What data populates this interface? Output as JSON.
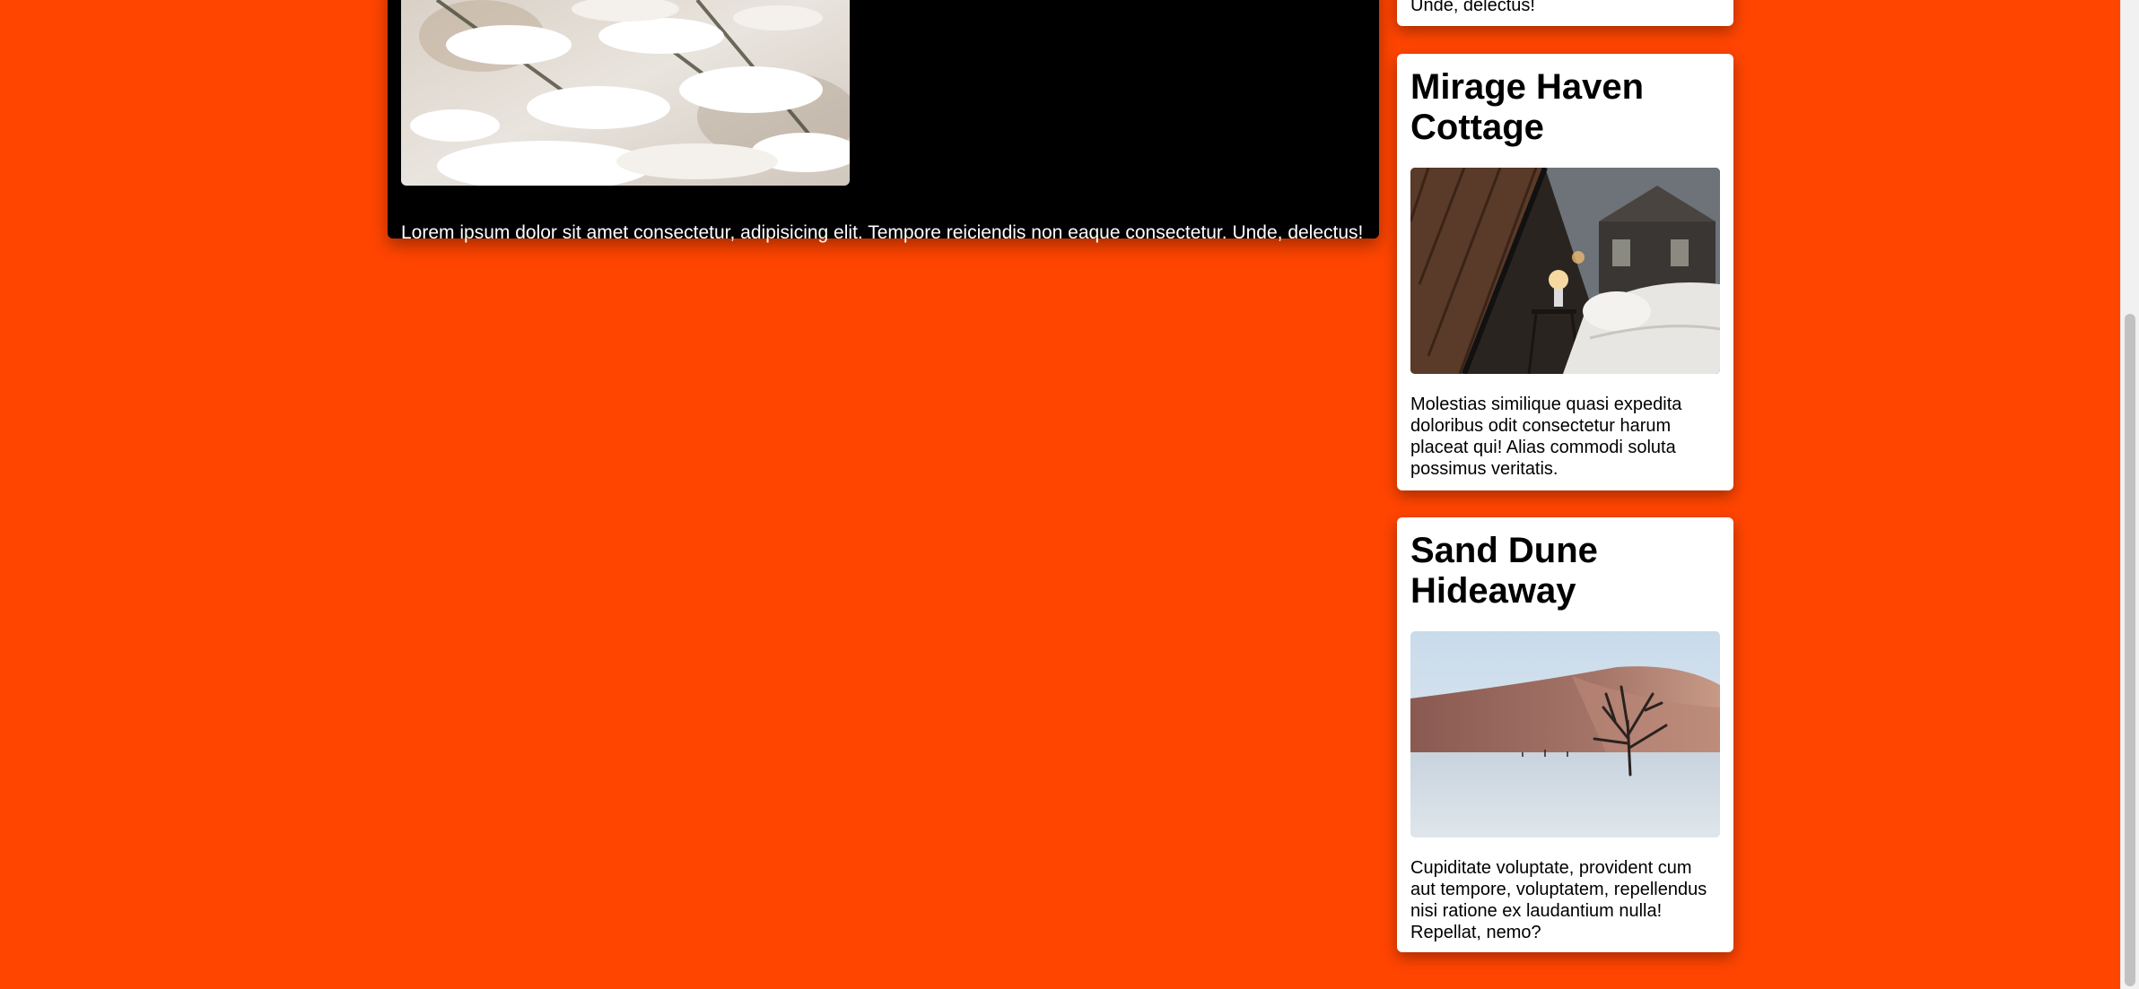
{
  "main_card": {
    "image_alt": "snow-covered-fir-branches",
    "caption": "Lorem ipsum dolor sit amet consectetur, adipisicing elit. Tempore reiciendis non eaque consectetur. Unde, delectus!"
  },
  "cards": [
    {
      "title": "",
      "description": "Unde, delectus!"
    },
    {
      "title": "Mirage Haven Cottage",
      "image_alt": "cabin-bedroom-with-lamp",
      "description": "Molestias similique quasi expedita doloribus odit consectetur harum placeat qui! Alias commodi soluta possimus veritatis."
    },
    {
      "title": "Sand Dune Hideaway",
      "image_alt": "dead-tree-in-desert-dunes",
      "description": "Cupiditate voluptate, provident cum aut tempore, voluptatem, repellendus nisi ratione ex laudantium nulla! Repellat, nemo?"
    }
  ],
  "colors": {
    "background": "#ff4500",
    "main_card": "#000000",
    "card": "#ffffff"
  }
}
